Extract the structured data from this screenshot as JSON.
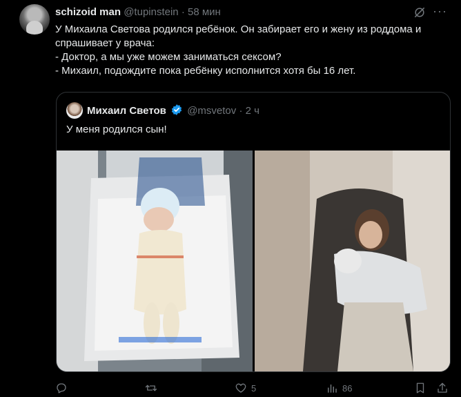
{
  "tweet": {
    "author_name": "schizoid man",
    "author_handle": "@tupinstein",
    "separator": "·",
    "time": "58 мин",
    "lines": [
      "У Михаила Светова родился ребёнок. Он забирает его и жену из роддома и",
      "спрашивает у врача:",
      "- Доктор, а мы уже можем заниматься сексом?",
      "- Михаил, подождите пока ребёнку исполнится хотя бы 16 лет."
    ]
  },
  "quote": {
    "author_name": "Михаил Светов",
    "author_handle": "@msvetov",
    "separator": "·",
    "time": "2 ч",
    "text": "У меня родился сын!"
  },
  "actions": {
    "reply_count": "",
    "retweet_count": "",
    "like_count": "5",
    "views_count": "86"
  },
  "icons": [
    "avatar",
    "grok-icon",
    "more-icon",
    "verified-badge-icon",
    "reply-icon",
    "retweet-icon",
    "like-icon",
    "views-icon",
    "bookmark-icon",
    "share-icon"
  ],
  "colors": {
    "background": "#000000",
    "text": "#e7e9ea",
    "muted": "#71767b",
    "verified": "#1d9bf0",
    "border": "#2f3336"
  }
}
